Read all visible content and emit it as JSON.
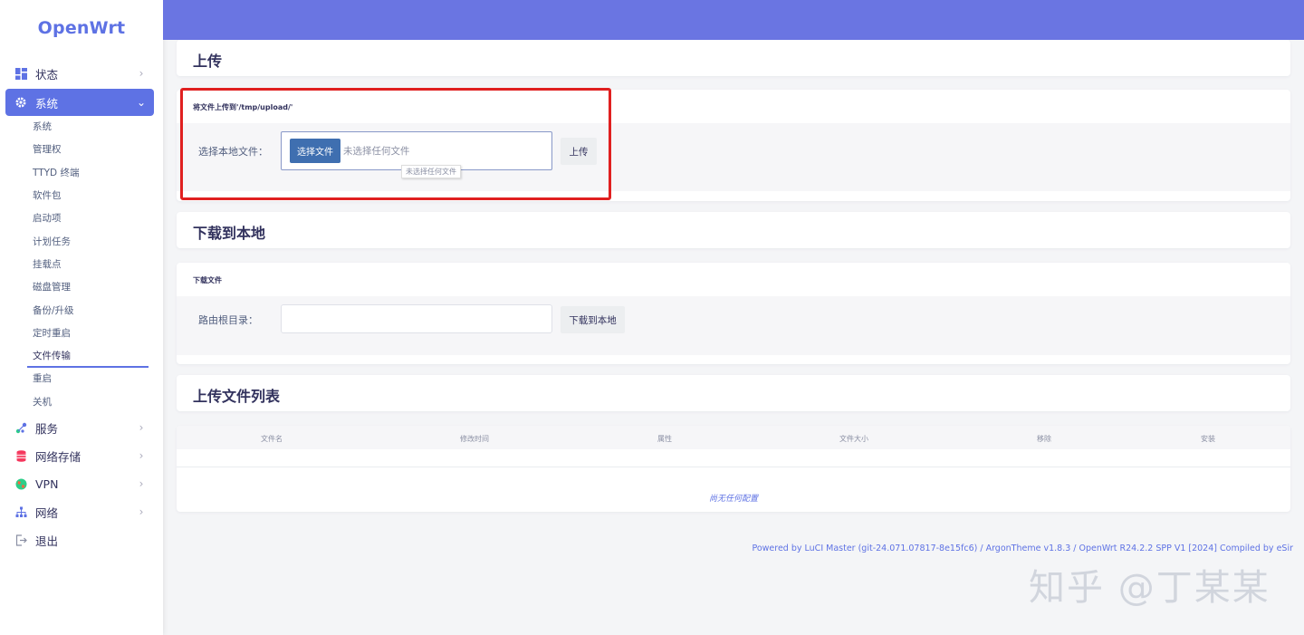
{
  "brand": "OpenWrt",
  "sidebar": {
    "items": [
      {
        "label": "状态",
        "icon": "dashboard-icon"
      },
      {
        "label": "系统",
        "icon": "gear-icon"
      },
      {
        "label": "服务",
        "icon": "share-icon"
      },
      {
        "label": "网络存储",
        "icon": "database-icon"
      },
      {
        "label": "VPN",
        "icon": "globe-icon"
      },
      {
        "label": "网络",
        "icon": "sitemap-icon"
      },
      {
        "label": "退出",
        "icon": "logout-icon"
      }
    ],
    "sub_items": [
      "系统",
      "管理权",
      "TTYD 终端",
      "软件包",
      "启动项",
      "计划任务",
      "挂载点",
      "磁盘管理",
      "备份/升级",
      "定时重启",
      "文件传输",
      "重启",
      "关机"
    ]
  },
  "upload": {
    "title": "上传",
    "section_label": "将文件上传到'/tmp/upload/'",
    "field_label": "选择本地文件：",
    "choose_button": "选择文件",
    "no_file": "未选择任何文件",
    "tooltip": "未选择任何文件",
    "upload_button": "上传"
  },
  "download": {
    "title": "下载到本地",
    "section_label": "下载文件",
    "field_label": "路由根目录：",
    "input_value": "",
    "download_button": "下载到本地"
  },
  "filelist": {
    "title": "上传文件列表",
    "columns": [
      "文件名",
      "修改时间",
      "属性",
      "文件大小",
      "移除",
      "安装"
    ],
    "empty_text": "尚无任何配置"
  },
  "footer": "Powered by LuCI Master (git-24.071.07817-8e15fc6) / ArgonTheme v1.8.3 / OpenWrt R24.2.2 SPP V1 [2024] Compiled by eSir",
  "watermark": "知乎 @丁某某",
  "colors": {
    "accent": "#5e72e4",
    "header": "#6a75e2",
    "highlight": "#e02020",
    "file_button": "#3f6fb0"
  }
}
